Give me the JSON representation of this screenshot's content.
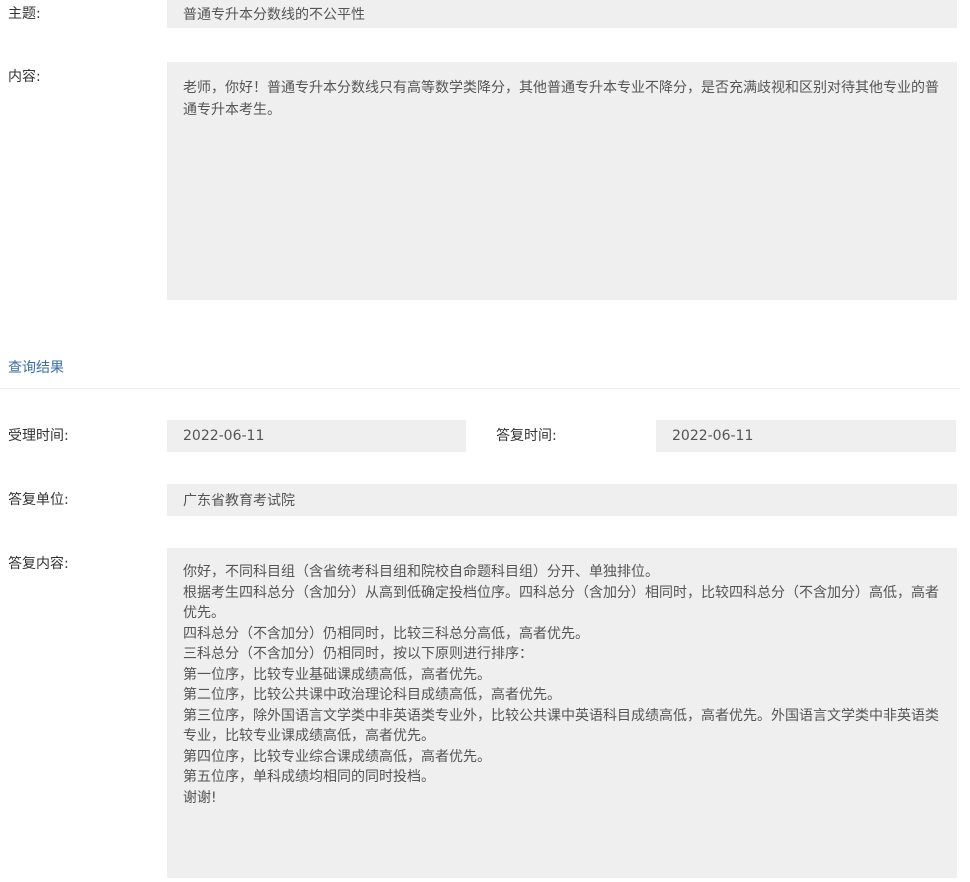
{
  "subject": {
    "label": "主题:",
    "value": "普通专升本分数线的不公平性"
  },
  "content": {
    "label": "内容:",
    "value": "老师，你好！普通专升本分数线只有高等数学类降分，其他普通专升本专业不降分，是否充满歧视和区别对待其他专业的普通专升本考生。"
  },
  "results_section": {
    "title": "查询结果"
  },
  "accept_time": {
    "label": "受理时间:",
    "value": "2022-06-11"
  },
  "reply_time": {
    "label": "答复时间:",
    "value": "2022-06-11"
  },
  "reply_unit": {
    "label": "答复单位:",
    "value": "广东省教育考试院"
  },
  "reply_content": {
    "label": "答复内容:",
    "value": "你好，不同科目组（含省统考科目组和院校自命题科目组）分开、单独排位。\n根据考生四科总分（含加分）从高到低确定投档位序。四科总分（含加分）相同时，比较四科总分（不含加分）高低，高者优先。\n四科总分（不含加分）仍相同时，比较三科总分高低，高者优先。\n三科总分（不含加分）仍相同时，按以下原则进行排序：\n第一位序，比较专业基础课成绩高低，高者优先。\n第二位序，比较公共课中政治理论科目成绩高低，高者优先。\n第三位序，除外国语言文学类中非英语类专业外，比较公共课中英语科目成绩高低，高者优先。外国语言文学类中非英语类专业，比较专业课成绩高低，高者优先。\n第四位序，比较专业综合课成绩高低，高者优先。\n第五位序，单科成绩均相同的同时投档。\n谢谢!"
  }
}
